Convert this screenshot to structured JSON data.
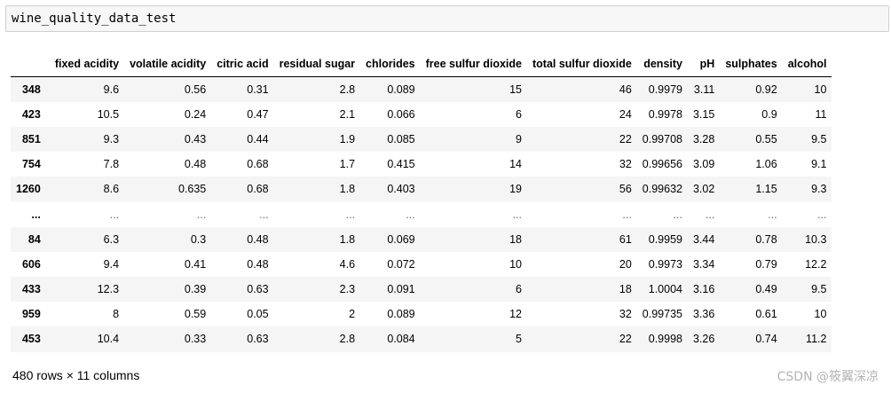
{
  "cell": {
    "code": "wine_quality_data_test"
  },
  "table": {
    "columns": [
      "fixed acidity",
      "volatile acidity",
      "citric acid",
      "residual sugar",
      "chlorides",
      "free sulfur dioxide",
      "total sulfur dioxide",
      "density",
      "pH",
      "sulphates",
      "alcohol"
    ],
    "rows": [
      {
        "index": "348",
        "values": [
          "9.6",
          "0.56",
          "0.31",
          "2.8",
          "0.089",
          "15",
          "46",
          "0.9979",
          "3.11",
          "0.92",
          "10"
        ]
      },
      {
        "index": "423",
        "values": [
          "10.5",
          "0.24",
          "0.47",
          "2.1",
          "0.066",
          "6",
          "24",
          "0.9978",
          "3.15",
          "0.9",
          "11"
        ]
      },
      {
        "index": "851",
        "values": [
          "9.3",
          "0.43",
          "0.44",
          "1.9",
          "0.085",
          "9",
          "22",
          "0.99708",
          "3.28",
          "0.55",
          "9.5"
        ]
      },
      {
        "index": "754",
        "values": [
          "7.8",
          "0.48",
          "0.68",
          "1.7",
          "0.415",
          "14",
          "32",
          "0.99656",
          "3.09",
          "1.06",
          "9.1"
        ]
      },
      {
        "index": "1260",
        "values": [
          "8.6",
          "0.635",
          "0.68",
          "1.8",
          "0.403",
          "19",
          "56",
          "0.99632",
          "3.02",
          "1.15",
          "9.3"
        ]
      },
      {
        "index": "...",
        "values": [
          "...",
          "...",
          "...",
          "...",
          "...",
          "...",
          "...",
          "...",
          "...",
          "...",
          "..."
        ]
      },
      {
        "index": "84",
        "values": [
          "6.3",
          "0.3",
          "0.48",
          "1.8",
          "0.069",
          "18",
          "61",
          "0.9959",
          "3.44",
          "0.78",
          "10.3"
        ]
      },
      {
        "index": "606",
        "values": [
          "9.4",
          "0.41",
          "0.48",
          "4.6",
          "0.072",
          "10",
          "20",
          "0.9973",
          "3.34",
          "0.79",
          "12.2"
        ]
      },
      {
        "index": "433",
        "values": [
          "12.3",
          "0.39",
          "0.63",
          "2.3",
          "0.091",
          "6",
          "18",
          "1.0004",
          "3.16",
          "0.49",
          "9.5"
        ]
      },
      {
        "index": "959",
        "values": [
          "8",
          "0.59",
          "0.05",
          "2",
          "0.089",
          "12",
          "32",
          "0.99735",
          "3.36",
          "0.61",
          "10"
        ]
      },
      {
        "index": "453",
        "values": [
          "10.4",
          "0.33",
          "0.63",
          "2.8",
          "0.084",
          "5",
          "22",
          "0.9998",
          "3.26",
          "0.74",
          "11.2"
        ]
      }
    ]
  },
  "footer": {
    "shape": "480 rows × 11 columns"
  },
  "watermark": {
    "text": "CSDN @筱翼深凉"
  },
  "colors": {
    "stripe": "#f5f5f5",
    "cell_background": "#f7f7f7",
    "cell_border": "#cfcfcf"
  }
}
